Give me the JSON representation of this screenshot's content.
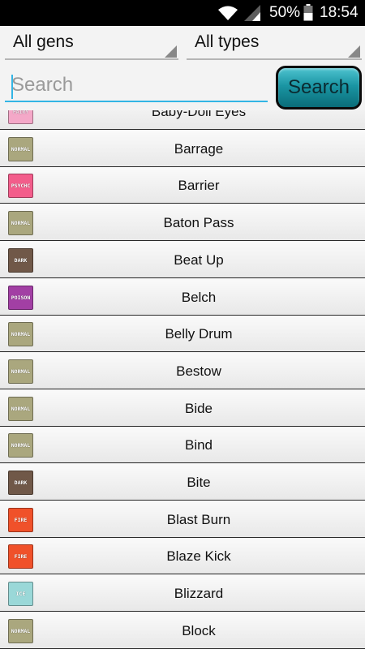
{
  "status_bar": {
    "battery_percent": "50%",
    "time": "18:54",
    "wifi_icon": "wifi-icon",
    "signal_icon": "cell-signal-icon",
    "battery_icon": "battery-icon"
  },
  "filters": {
    "generation": "All gens",
    "type": "All types"
  },
  "search": {
    "placeholder": "Search",
    "value": "",
    "button_label": "Search"
  },
  "colors": {
    "accent": "#33b5e5",
    "button": "#1a95a3"
  },
  "moves": [
    {
      "name": "Baby-Doll Eyes",
      "type": "FAIRY",
      "color": "#f4a8c8",
      "text_color": "#f0dbe6"
    },
    {
      "name": "Barrage",
      "type": "NORMAL",
      "color": "#aaa77e",
      "text_color": "#ffffff"
    },
    {
      "name": "Barrier",
      "type": "PSYCHC",
      "color": "#f35d8b",
      "text_color": "#ffffff"
    },
    {
      "name": "Baton Pass",
      "type": "NORMAL",
      "color": "#aaa77e",
      "text_color": "#ffffff"
    },
    {
      "name": "Beat Up",
      "type": "DARK",
      "color": "#705848",
      "text_color": "#ffffff"
    },
    {
      "name": "Belch",
      "type": "POISON",
      "color": "#a23fa4",
      "text_color": "#ffffff"
    },
    {
      "name": "Belly Drum",
      "type": "NORMAL",
      "color": "#aaa77e",
      "text_color": "#ffffff"
    },
    {
      "name": "Bestow",
      "type": "NORMAL",
      "color": "#aaa77e",
      "text_color": "#ffffff"
    },
    {
      "name": "Bide",
      "type": "NORMAL",
      "color": "#aaa77e",
      "text_color": "#ffffff"
    },
    {
      "name": "Bind",
      "type": "NORMAL",
      "color": "#aaa77e",
      "text_color": "#ffffff"
    },
    {
      "name": "Bite",
      "type": "DARK",
      "color": "#705848",
      "text_color": "#ffffff"
    },
    {
      "name": "Blast Burn",
      "type": "FIRE",
      "color": "#f0512a",
      "text_color": "#ffffff"
    },
    {
      "name": "Blaze Kick",
      "type": "FIRE",
      "color": "#f0512a",
      "text_color": "#ffffff"
    },
    {
      "name": "Blizzard",
      "type": "ICE",
      "color": "#9ad8d8",
      "text_color": "#ffffff"
    },
    {
      "name": "Block",
      "type": "NORMAL",
      "color": "#aaa77e",
      "text_color": "#ffffff"
    }
  ]
}
